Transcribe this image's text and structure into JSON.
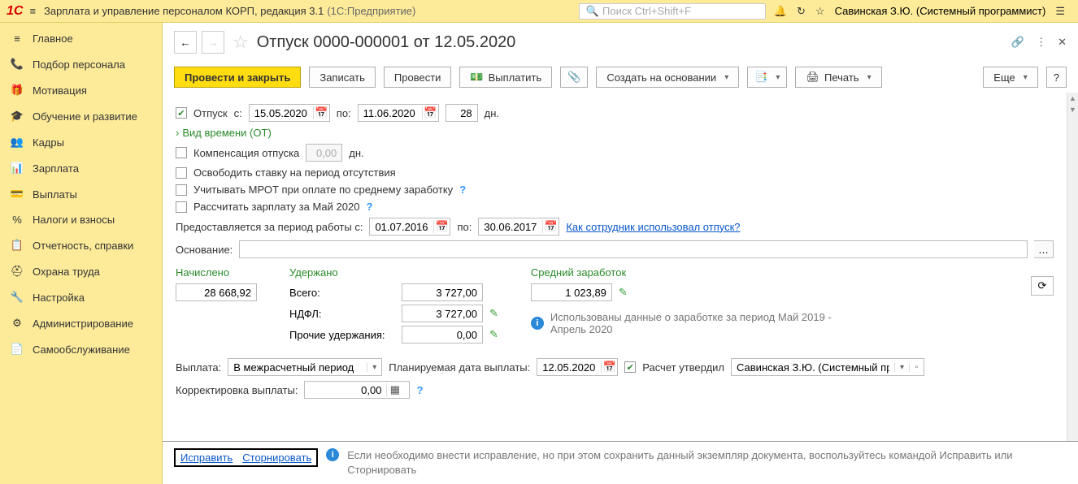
{
  "app": {
    "logo": "1С",
    "title": "Зарплата и управление персоналом КОРП, редакция 3.1",
    "sub": "(1С:Предприятие)",
    "search_placeholder": "Поиск Ctrl+Shift+F",
    "user": "Савинская З.Ю. (Системный программист)"
  },
  "sidebar": {
    "items": [
      {
        "icon": "≡",
        "label": "Главное"
      },
      {
        "icon": "📞",
        "label": "Подбор персонала"
      },
      {
        "icon": "🎁",
        "label": "Мотивация"
      },
      {
        "icon": "🎓",
        "label": "Обучение и развитие"
      },
      {
        "icon": "👥",
        "label": "Кадры"
      },
      {
        "icon": "📊",
        "label": "Зарплата"
      },
      {
        "icon": "💳",
        "label": "Выплаты"
      },
      {
        "icon": "%",
        "label": "Налоги и взносы"
      },
      {
        "icon": "📋",
        "label": "Отчетность, справки"
      },
      {
        "icon": "⛑",
        "label": "Охрана труда"
      },
      {
        "icon": "🔧",
        "label": "Настройка"
      },
      {
        "icon": "⚙",
        "label": "Администрирование"
      },
      {
        "icon": "📄",
        "label": "Самообслуживание"
      }
    ]
  },
  "doc": {
    "title": "Отпуск 0000-000001 от 12.05.2020",
    "toolbar": {
      "post_close": "Провести и закрыть",
      "save": "Записать",
      "post": "Провести",
      "pay": "Выплатить",
      "create_based": "Создать на основании",
      "print": "Печать",
      "more": "Еще",
      "help": "?"
    },
    "form": {
      "vacation_label": "Отпуск",
      "from_label": "с:",
      "date_from": "15.05.2020",
      "to_label": "по:",
      "date_to": "11.06.2020",
      "days": "28",
      "days_label": "дн.",
      "time_type": "Вид времени (ОТ)",
      "compensation": "Компенсация отпуска",
      "comp_days": "0,00",
      "comp_dn": "дн.",
      "free_rate": "Освободить ставку на период отсутствия",
      "mrot": "Учитывать МРОТ при оплате по среднему заработку",
      "calc_salary": "Рассчитать зарплату за Май 2020",
      "period_label": "Предоставляется за период работы с:",
      "period_from": "01.07.2016",
      "period_to_label": "по:",
      "period_to": "30.06.2017",
      "usage_link": "Как сотрудник использовал отпуск?",
      "reason_label": "Основание:"
    },
    "calc": {
      "accrued_label": "Начислено",
      "accrued": "28 668,92",
      "deducted_label": "Удержано",
      "total_label": "Всего:",
      "total": "3 727,00",
      "ndfl_label": "НДФЛ:",
      "ndfl": "3 727,00",
      "other_label": "Прочие удержания:",
      "other": "0,00",
      "avg_label": "Средний заработок",
      "avg": "1 023,89",
      "info": "Использованы данные о заработке за период Май 2019 - Апрель 2020"
    },
    "payment": {
      "label": "Выплата:",
      "mode": "В межрасчетный период",
      "planned_label": "Планируемая дата выплаты:",
      "planned_date": "12.05.2020",
      "approved_label": "Расчет утвердил",
      "approved_by": "Савинская З.Ю. (Системный про",
      "corr_label": "Корректировка выплаты:",
      "corr_val": "0,00"
    },
    "footer": {
      "fix": "Исправить",
      "reverse": "Сторнировать",
      "text": "Если необходимо внести исправление, но при этом сохранить данный экземпляр документа, воспользуйтесь командой Исправить или Сторнировать"
    }
  }
}
